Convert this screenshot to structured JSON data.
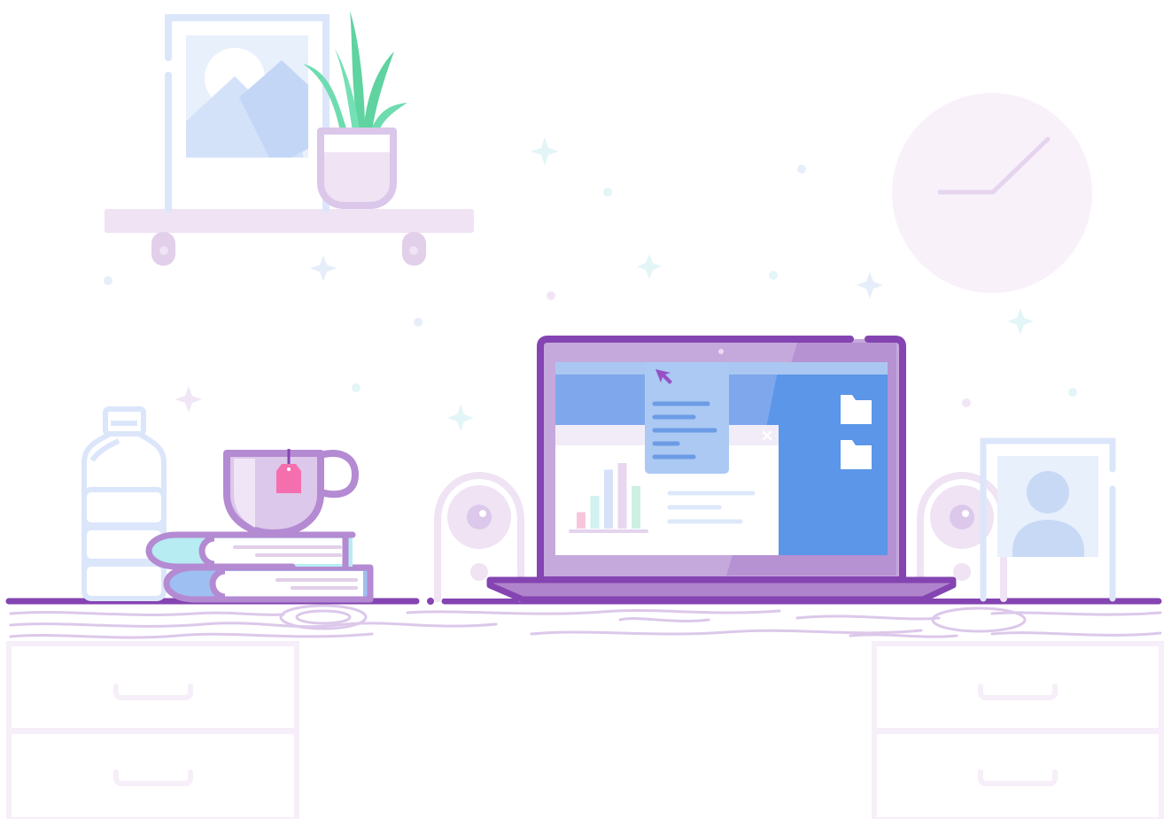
{
  "scene": {
    "palette": {
      "accent_purple": "#8444b1",
      "laptop_body": "#b084cc",
      "screen_blue": "#5b96e8",
      "frame_blue": "#d9e5fb",
      "lilac": "#efe3f4",
      "plant_green": "#5fd3a0",
      "tea_tag_pink": "#f56fae",
      "book_cyan": "#b6ecf2",
      "book_blue": "#9ebff1",
      "wood_grain": "#dcc8ea"
    },
    "laptop_screen": {
      "chart_bars": [
        0.25,
        0.5,
        0.9,
        1.0,
        0.65
      ],
      "menu_items": 5,
      "folder_icons": 2
    }
  }
}
